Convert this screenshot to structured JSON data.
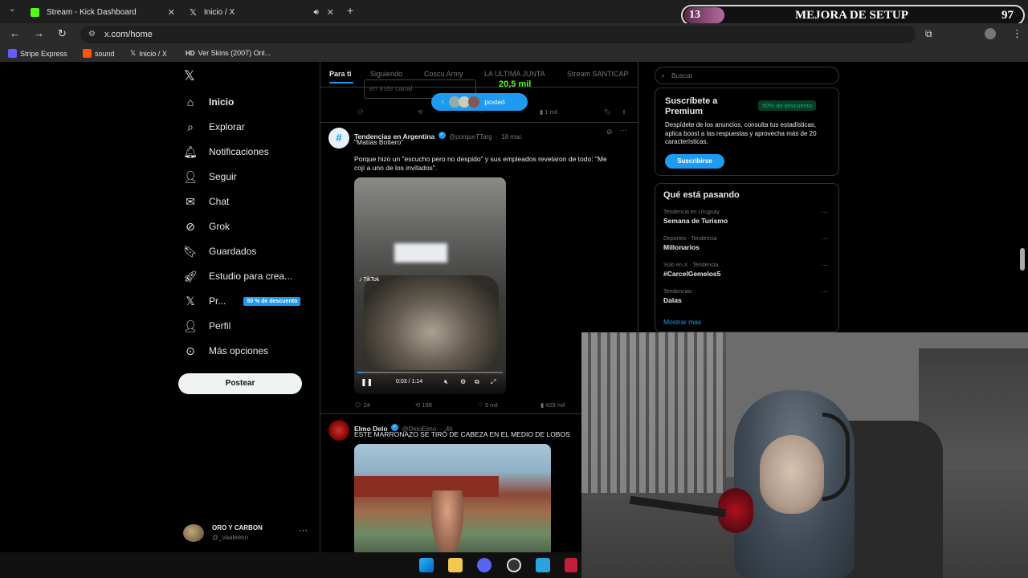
{
  "tabs": [
    {
      "label": "Stream - Kick Dashboard"
    },
    {
      "label": "Inicio / X"
    }
  ],
  "address": "x.com/home",
  "bookmarks": [
    "Stripe Express",
    "sound",
    "Inicio / X",
    "Ver Skins (2007) Onl..."
  ],
  "overlay": {
    "left_number": "13",
    "title": "MEJORA DE SETUP",
    "right_number": "97"
  },
  "nav": {
    "items": [
      "Inicio",
      "Explorar",
      "Notificaciones",
      "Seguir",
      "Chat",
      "Grok",
      "Guardados",
      "Estudio para crea...",
      "Pr...",
      "Perfil",
      "Más opciones"
    ],
    "premium_badge": "50 % de descuento",
    "post_button": "Postear",
    "account_name": "ORO Y CARBON",
    "account_handle": "@_vaaleenn"
  },
  "feed": {
    "tabs": [
      "Para ti",
      "Siguiendo",
      "Coscu Army",
      "LA ULTIMA JUNTA",
      "Stream SANTICAP"
    ],
    "top_partial": {
      "placeholder": "en este canal",
      "count": "20,5 mil",
      "views": "1 mil"
    },
    "posted_pill": "posteó",
    "post1": {
      "author": "Tendencias en Argentina",
      "handle": "@porqueTTarg",
      "date": "18 mar.",
      "line1": "\"Matías Bottero\"",
      "text": "Porque hizo un \"escucho pero no despido\" y sus empleados revelaron de todo: \"Me cojí a uno de los invitados\".",
      "video_time": "0:03 / 1:14",
      "replies": "24",
      "reposts": "198",
      "likes": "9 mil",
      "views": "429 mil"
    },
    "post2": {
      "author": "Elmo Delo",
      "handle": "@DeloElmo",
      "date": "4h",
      "text": "ESTE MARRONAZO SE TIRÓ DE CABEZA EN EL MEDIO DE LOBOS"
    }
  },
  "sidebar": {
    "search_placeholder": "Buscar",
    "premium": {
      "title": "Suscríbete a Premium",
      "badge": "50% de descuento",
      "desc": "Despídete de los anuncios, consulta tus estadísticas, aplica boost a las respuestas y aprovecha más de 20 características.",
      "button": "Suscribirse"
    },
    "trends_title": "Qué está pasando",
    "trends": [
      {
        "meta": "Tendencia en Uruguay",
        "title": "Semana de Turismo"
      },
      {
        "meta": "Deportes · Tendencia",
        "title": "Millonarios"
      },
      {
        "meta": "Solo en X · Tendencia",
        "title": "#CarcelGemelos5"
      },
      {
        "meta": "Tendencias",
        "title": "Dalas"
      }
    ],
    "show_more": "Mostrar más"
  },
  "colors": {
    "accent": "#1d9bf0",
    "kick_green": "#53fc18",
    "premium_green": "#00ba7c"
  }
}
